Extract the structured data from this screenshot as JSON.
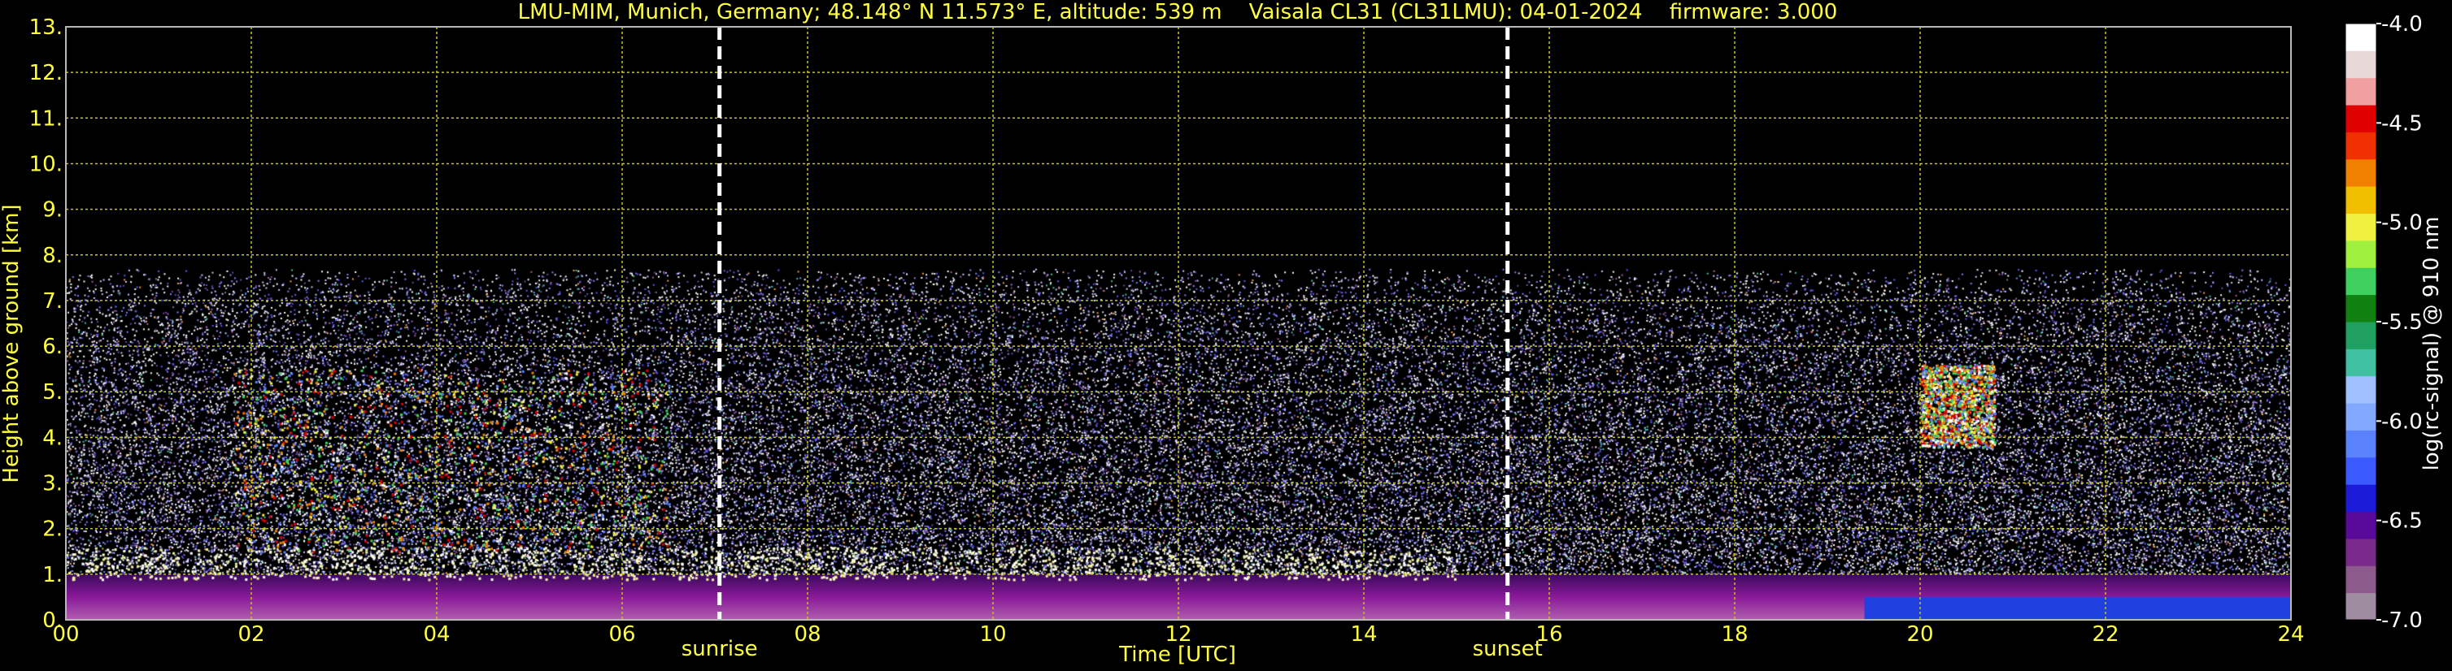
{
  "chart_data": {
    "type": "heatmap",
    "title": "LMU-MIM, Munich, Germany; 48.148° N 11.573° E, altitude: 539 m    Vaisala CL31 (CL31LMU): 04-01-2024    firmware: 3.000",
    "xlabel": "Time [UTC]",
    "ylabel": "Height above ground [km]",
    "xlim": [
      0,
      24
    ],
    "ylim": [
      0,
      13
    ],
    "x_ticks": [
      "00",
      "02",
      "04",
      "06",
      "08",
      "10",
      "12",
      "14",
      "16",
      "18",
      "20",
      "22",
      "24"
    ],
    "y_ticks": [
      "0.",
      "1.",
      "2.",
      "3.",
      "4.",
      "5.",
      "6.",
      "7.",
      "8.",
      "9.",
      "10.",
      "11.",
      "12.",
      "13."
    ],
    "grid": true,
    "signal_top_km": 7.7,
    "annotations": [
      {
        "label": "sunrise",
        "x": 7.05
      },
      {
        "label": "sunset",
        "x": 15.55
      }
    ],
    "colorbar": {
      "label": "log(rc-signal) @ 910 nm",
      "ticks": [
        "-4.0",
        "-4.5",
        "-5.0",
        "-5.5",
        "-6.0",
        "-6.5",
        "-7.0"
      ],
      "range": [
        -7.0,
        -4.0
      ],
      "colors": [
        "#a08ca0",
        "#8c5a8c",
        "#7a2a8a",
        "#5a0a9a",
        "#1a1ad8",
        "#3a5aff",
        "#5a82ff",
        "#82a8ff",
        "#a0c0ff",
        "#40c0a0",
        "#20a060",
        "#108010",
        "#40d060",
        "#a0f040",
        "#f0f040",
        "#f0c000",
        "#f08000",
        "#f03000",
        "#e00000",
        "#f0a0a0",
        "#e8d8d8",
        "#ffffff"
      ]
    },
    "features": [
      {
        "name": "boundary layer aerosol",
        "x_range": [
          0,
          24
        ],
        "height_range": [
          0,
          1.0
        ]
      },
      {
        "name": "low cloud layer",
        "x_range": [
          0,
          15
        ],
        "height_range": [
          0.9,
          1.6
        ]
      },
      {
        "name": "mid-level clouds",
        "x_range": [
          1.8,
          6.5
        ],
        "height_range": [
          1.5,
          5.5
        ]
      },
      {
        "name": "cloud",
        "x_range": [
          20.0,
          20.8
        ],
        "height_range": [
          3.8,
          5.6
        ]
      }
    ]
  }
}
